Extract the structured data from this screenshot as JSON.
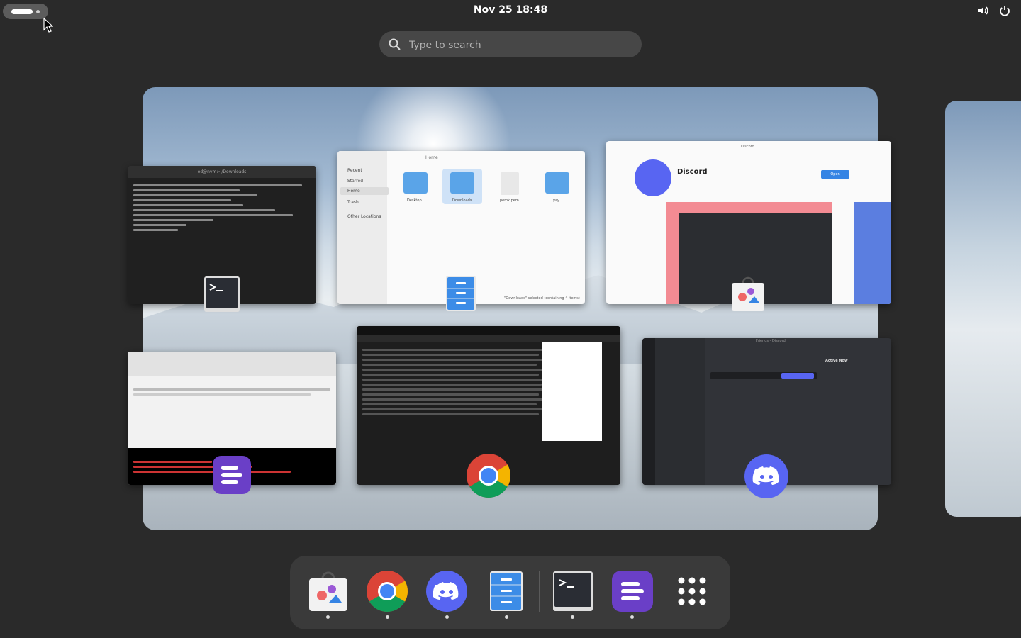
{
  "topbar": {
    "clock": "Nov 25  18:48",
    "tray_icons": [
      "volume-icon",
      "power-icon"
    ]
  },
  "search": {
    "placeholder": "Type to search"
  },
  "overview": {
    "windows": [
      {
        "app": "Terminal",
        "title": "ed@nvm:~/Downloads"
      },
      {
        "app": "Files",
        "title": "Home",
        "sidebar": [
          "Recent",
          "Starred",
          "Home",
          "Trash",
          "Other Locations"
        ],
        "items": [
          "Desktop",
          "Downloads",
          "pemk.pem",
          "yay"
        ],
        "status": "\"Downloads\" selected (containing 4 items)"
      },
      {
        "app": "Software",
        "title": "Discord",
        "app_name": "Discord",
        "button": "Open"
      },
      {
        "app": "Gtkhash",
        "title": ""
      },
      {
        "app": "Google Chrome",
        "title": ""
      },
      {
        "app": "Discord",
        "title": "Friends - Discord",
        "active_now": "Active Now"
      }
    ]
  },
  "dash": {
    "apps": [
      {
        "name": "Software",
        "running": true
      },
      {
        "name": "Google Chrome",
        "running": true
      },
      {
        "name": "Discord",
        "running": true
      },
      {
        "name": "Files",
        "running": true
      },
      {
        "name": "Terminal",
        "running": true
      },
      {
        "name": "Gtkhash",
        "running": true
      },
      {
        "name": "Show Apps",
        "running": false
      }
    ]
  },
  "colors": {
    "background": "#2a2a2a",
    "dash": "#3a3a3a",
    "discord": "#5865f2",
    "files": "#5aa4e8"
  }
}
